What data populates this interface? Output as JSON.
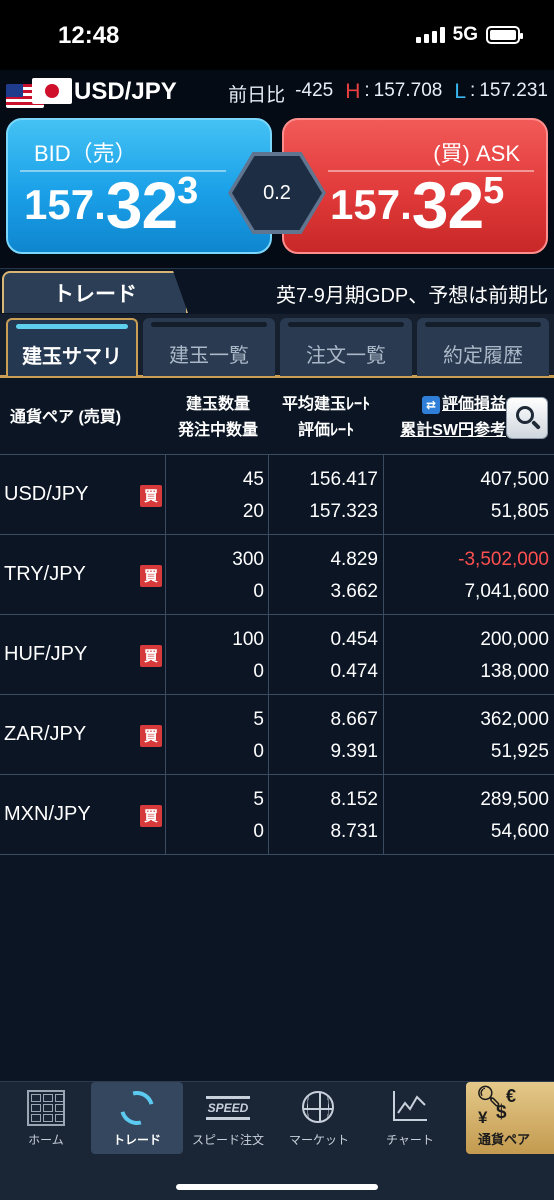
{
  "status": {
    "time": "12:48",
    "network": "5G"
  },
  "pair": {
    "name": "USD/JPY",
    "change_label": "前日比",
    "change_value": "-425",
    "high_label": "H",
    "high_value": "157.708",
    "low_label": "L",
    "low_value": "157.231"
  },
  "rates": {
    "bid_label": "BID（売）",
    "bid_small": "157.",
    "bid_big": "32",
    "bid_pip": "3",
    "ask_label": "(買) ASK",
    "ask_small": "157.",
    "ask_big": "32",
    "ask_pip": "5",
    "spread": "0.2",
    "bid_color": "#1aa0e8",
    "ask_color": "#e13a3a"
  },
  "trade_tab": "トレード",
  "news": "英7-9月期GDP、予想は前期比",
  "subtabs": [
    {
      "label": "建玉サマリ",
      "active": true
    },
    {
      "label": "建玉一覧",
      "active": false
    },
    {
      "label": "注文一覧",
      "active": false
    },
    {
      "label": "約定履歴",
      "active": false
    }
  ],
  "table": {
    "headers": {
      "pair": "通貨ペア (売買)",
      "qty": "建玉数量",
      "pending_qty": "発注中数量",
      "avg_rate": "平均建玉ﾚｰﾄ",
      "eval_rate": "評価ﾚｰﾄ",
      "pnl": "評価損益",
      "cumulative": "累計SW円参考"
    },
    "rows": [
      {
        "pair": "USD/JPY",
        "side": "買",
        "qty": "45",
        "pending": "20",
        "avg": "156.417",
        "eval": "157.323",
        "pnl": "407,500",
        "swap": "51,805",
        "negative": false
      },
      {
        "pair": "TRY/JPY",
        "side": "買",
        "qty": "300",
        "pending": "0",
        "avg": "4.829",
        "eval": "3.662",
        "pnl": "-3,502,000",
        "swap": "7,041,600",
        "negative": true
      },
      {
        "pair": "HUF/JPY",
        "side": "買",
        "qty": "100",
        "pending": "0",
        "avg": "0.454",
        "eval": "0.474",
        "pnl": "200,000",
        "swap": "138,000",
        "negative": false
      },
      {
        "pair": "ZAR/JPY",
        "side": "買",
        "qty": "5",
        "pending": "0",
        "avg": "8.667",
        "eval": "9.391",
        "pnl": "362,000",
        "swap": "51,925",
        "negative": false
      },
      {
        "pair": "MXN/JPY",
        "side": "買",
        "qty": "5",
        "pending": "0",
        "avg": "8.152",
        "eval": "8.731",
        "pnl": "289,500",
        "swap": "54,600",
        "negative": false
      }
    ]
  },
  "tabbar": {
    "items": [
      {
        "label": "ホーム",
        "icon": "home-grid-icon"
      },
      {
        "label": "トレード",
        "icon": "refresh-arrows-icon",
        "active": true
      },
      {
        "label": "スピード注文",
        "icon": "speed-icon",
        "icon_text": "SPEED"
      },
      {
        "label": "マーケット",
        "icon": "globe-icon"
      },
      {
        "label": "チャート",
        "icon": "chart-icon"
      }
    ],
    "currency_button": {
      "label": "通貨ペア",
      "symbols": [
        "€",
        "¥",
        "$"
      ]
    }
  }
}
